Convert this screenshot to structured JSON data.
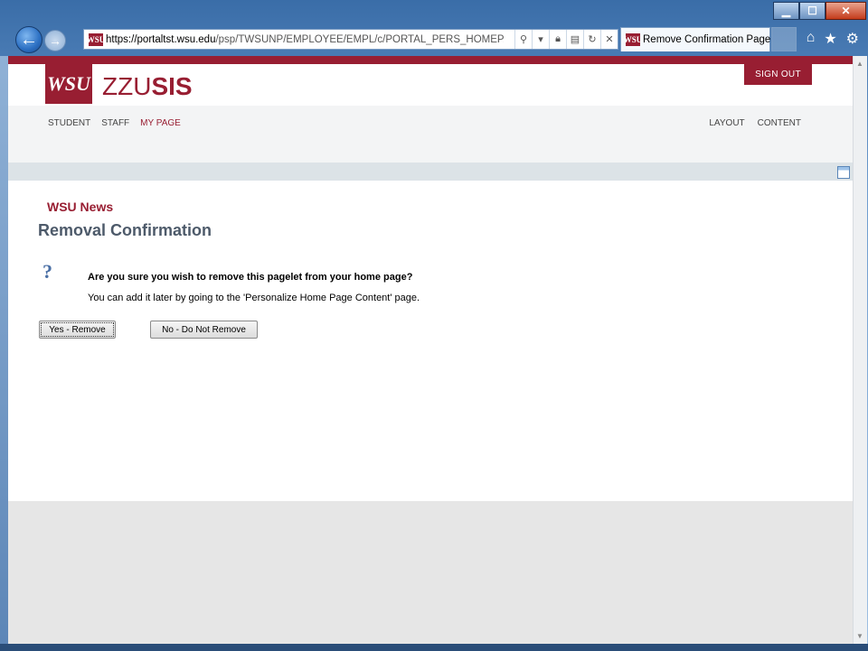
{
  "browser": {
    "url_prefix": "https://",
    "url_host": "portaltst.wsu.edu",
    "url_path": "/psp/TWSUNP/EMPLOYEE/EMPL/c/PORTAL_PERS_HOMEPAGE",
    "tab_title": "Remove Confirmation Page",
    "favicon_text": "WSU",
    "icons": [
      "back-arrow-icon",
      "forward-arrow-icon",
      "search-icon",
      "dropdown-icon",
      "lock-icon",
      "compat-icon",
      "refresh-icon",
      "stop-icon",
      "home-icon",
      "favorites-star-icon",
      "gear-icon"
    ]
  },
  "header": {
    "logo_text": "WSU",
    "site_name_prefix": "ZZU",
    "site_name_suffix": "SIS",
    "sign_out": "SIGN OUT"
  },
  "nav": {
    "left": [
      {
        "label": "STUDENT",
        "active": false
      },
      {
        "label": "STAFF",
        "active": false
      },
      {
        "label": "MY PAGE",
        "active": true
      }
    ],
    "right": [
      {
        "label": "LAYOUT"
      },
      {
        "label": "CONTENT"
      }
    ]
  },
  "main": {
    "pagelet_title": "WSU News",
    "heading": "Removal Confirmation",
    "question_icon": "?",
    "question": "Are you sure you wish to remove this pagelet from your home page?",
    "note": "You can add it later by going to the 'Personalize Home Page Content' page.",
    "yes_button": "Yes - Remove",
    "no_button": "No - Do Not Remove"
  },
  "colors": {
    "brand": "#981e32",
    "heading": "#4d5a6a",
    "divider": "#dce3e7",
    "footer": "#e6e6e6"
  }
}
